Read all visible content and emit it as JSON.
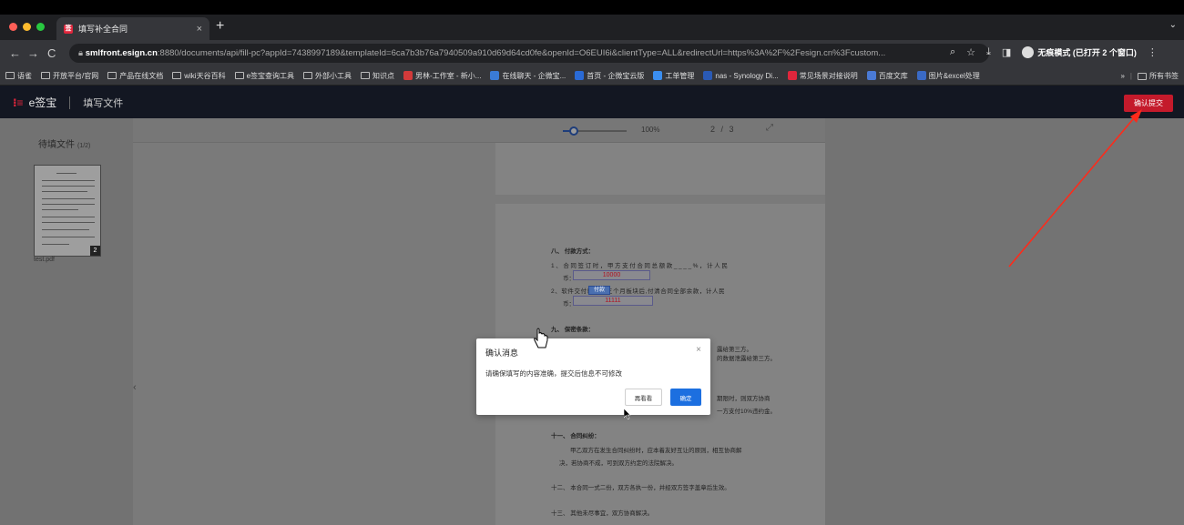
{
  "browser": {
    "tab_title": "填写补全合同",
    "tab_close": "×",
    "new_tab": "+",
    "tab_menu": "⌄",
    "url_host": "smlfront.esign.cn",
    "url_rest": ":8880/documents/api/fill-pc?appId=7438997189&templateId=6ca7b3b76a7940509a910d69d64cd0fe&openId=O6EUI6i&clientType=ALL&redirectUrl=https%3A%2F%2Fesign.cn%3Fcustom...",
    "incognito_label": "无痕模式 (已打开 2 个窗口)",
    "bookmarks": [
      {
        "label": "语雀",
        "icon": "folder-icon"
      },
      {
        "label": "开放平台/官网",
        "icon": "folder-icon"
      },
      {
        "label": "产品在线文档",
        "icon": "folder-icon"
      },
      {
        "label": "wiki天谷百科",
        "icon": "folder-icon"
      },
      {
        "label": "e签宝查询工具",
        "icon": "folder-icon"
      },
      {
        "label": "外部小工具",
        "icon": "folder-icon"
      },
      {
        "label": "知识点",
        "icon": "folder-icon"
      },
      {
        "label": "男林-工作室 - 新小...",
        "icon": "app-icon",
        "color": "#d23a3a"
      },
      {
        "label": "在线聊天 - 企微宝...",
        "icon": "app-icon",
        "color": "#3a7bd5"
      },
      {
        "label": "首页 - 企微宝云版",
        "icon": "app-icon",
        "color": "#2a6ad5"
      },
      {
        "label": "工单管理",
        "icon": "app-icon",
        "color": "#3b8ef0"
      },
      {
        "label": "nas - Synology Di...",
        "icon": "app-icon",
        "color": "#2a5ab5"
      },
      {
        "label": "常见场景对接说明",
        "icon": "app-icon",
        "color": "#e0263c"
      },
      {
        "label": "百度文库",
        "icon": "app-icon",
        "color": "#4a7ad5"
      },
      {
        "label": "图片&excel处理",
        "icon": "app-icon",
        "color": "#3a6ac5"
      }
    ],
    "bookmarks_more": "»",
    "all_bookmarks": "所有书签"
  },
  "app": {
    "logo": "e签宝",
    "section": "填写文件",
    "confirm_submit": "确认提交"
  },
  "sidebar": {
    "title": "待填文件",
    "count": "(1/2)",
    "thumb_page": "2",
    "file_name": "test.pdf"
  },
  "viewer": {
    "zoom": "100%",
    "page_indicator": "2 / 3",
    "zoom_level": 0.1
  },
  "document": {
    "section8_title": "八、 付款方式：",
    "line1": "1、合同签订时，甲方支付合同总额款____%，计人民",
    "line1b": "币：",
    "field1_value": "10000",
    "line2": "2、软件交付验收后三个月板块后,付清合同全部余款，计人民",
    "line2b": "币：",
    "field2_value": "11111",
    "field_sel_label": "付款",
    "section9_title": "九、 保密条款：",
    "sec9_r1": "露给第三方。",
    "sec9_r2": "的数据泄露给第三方。",
    "sec10_r1": "期限时，则双方协商",
    "sec10_r2": "一方支付10%违约金。",
    "section11_title": "十一、 合同纠纷：",
    "sec11_l1": "甲乙双方在发生合同纠纷时，应本着友好互让的原则，相互协商解",
    "sec11_l2": "决，若协商不成，可到双方约定的法院解决。",
    "section12": "十二、 本合同一式二份，双方各执一份，并经双方签字盖章后生效。",
    "section13": "十三、 其他未尽事宜，双方协商解决。"
  },
  "dialog": {
    "title": "确认消息",
    "close": "×",
    "message": "请确保填写的内容准确，提交后信息不可修改",
    "recheck": "再看看",
    "ok": "确定"
  },
  "colors": {
    "brand_red": "#c41a2b",
    "primary_blue": "#1c6fe0",
    "annotation_arrow": "#ff2a1a"
  }
}
